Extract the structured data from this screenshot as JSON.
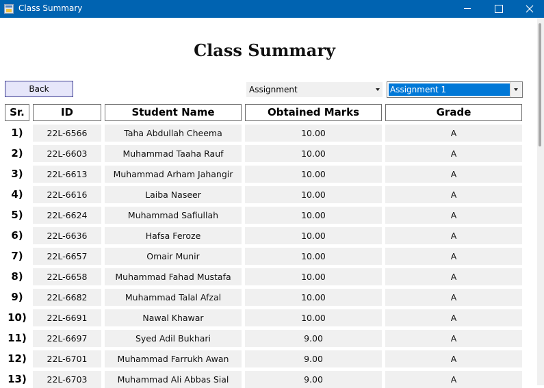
{
  "window": {
    "title": "Class Summary",
    "accent_color": "#0063b1"
  },
  "page": {
    "heading": "Class Summary",
    "back_label": "Back"
  },
  "filters": {
    "type_value": "Assignment",
    "item_value": "Assignment 1"
  },
  "table": {
    "headers": [
      "Sr.",
      "ID",
      "Student Name",
      "Obtained Marks",
      "Grade"
    ],
    "rows": [
      {
        "sr": "1)",
        "id": "22L-6566",
        "name": "Taha Abdullah Cheema",
        "marks": "10.00",
        "grade": "A"
      },
      {
        "sr": "2)",
        "id": "22L-6603",
        "name": "Muhammad Taaha Rauf",
        "marks": "10.00",
        "grade": "A"
      },
      {
        "sr": "3)",
        "id": "22L-6613",
        "name": "Muhammad Arham Jahangir",
        "marks": "10.00",
        "grade": "A"
      },
      {
        "sr": "4)",
        "id": "22L-6616",
        "name": "Laiba Naseer",
        "marks": "10.00",
        "grade": "A"
      },
      {
        "sr": "5)",
        "id": "22L-6624",
        "name": "Muhammad Safiullah",
        "marks": "10.00",
        "grade": "A"
      },
      {
        "sr": "6)",
        "id": "22L-6636",
        "name": "Hafsa Feroze",
        "marks": "10.00",
        "grade": "A"
      },
      {
        "sr": "7)",
        "id": "22L-6657",
        "name": "Omair Munir",
        "marks": "10.00",
        "grade": "A"
      },
      {
        "sr": "8)",
        "id": "22L-6658",
        "name": "Muhammad Fahad Mustafa",
        "marks": "10.00",
        "grade": "A"
      },
      {
        "sr": "9)",
        "id": "22L-6682",
        "name": "Muhammad Talal Afzal",
        "marks": "10.00",
        "grade": "A"
      },
      {
        "sr": "10)",
        "id": "22L-6691",
        "name": "Nawal Khawar",
        "marks": "10.00",
        "grade": "A"
      },
      {
        "sr": "11)",
        "id": "22L-6697",
        "name": "Syed Adil Bukhari",
        "marks": "9.00",
        "grade": "A"
      },
      {
        "sr": "12)",
        "id": "22L-6701",
        "name": "Muhammad Farrukh Awan",
        "marks": "9.00",
        "grade": "A"
      },
      {
        "sr": "13)",
        "id": "22L-6703",
        "name": "Muhammad Ali Abbas Sial",
        "marks": "9.00",
        "grade": "A"
      }
    ]
  },
  "icons": {
    "app": "app-window-icon",
    "minimize": "minimize-icon",
    "maximize": "maximize-icon",
    "close": "close-icon",
    "dropdown": "chevron-down-icon"
  }
}
